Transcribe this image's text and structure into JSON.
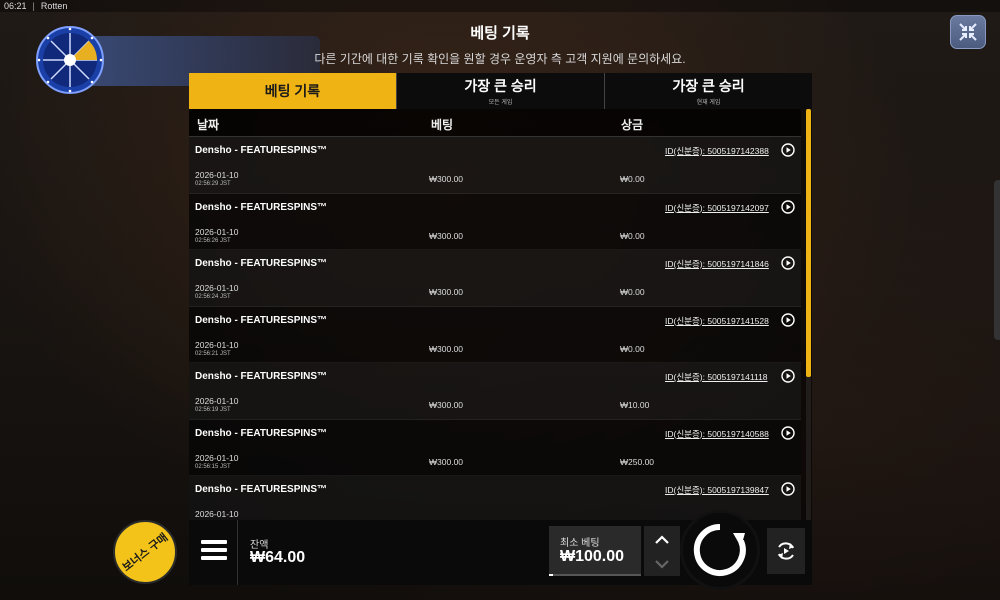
{
  "status_bar": {
    "time": "06:21",
    "app": "Rotten"
  },
  "header": {
    "title": "베팅 기록",
    "subtitle": "다른 기간에 대한 기록 확인을 원할 경우 운영자 측 고객 지원에 문의하세요."
  },
  "tabs": [
    {
      "label": "베팅 기록",
      "sub": "",
      "active": true
    },
    {
      "label": "가장 큰 승리",
      "sub": "모든 게임",
      "active": false
    },
    {
      "label": "가장 큰 승리",
      "sub": "현재 게임",
      "active": false
    }
  ],
  "table": {
    "headers": {
      "date": "날짜",
      "bet": "베팅",
      "win": "상금"
    },
    "rows": [
      {
        "game": "Densho - FEATURESPINS™",
        "date": "2026-01-10",
        "time": "02:56:29 JST",
        "bet": "₩300.00",
        "win": "₩0.00",
        "id": "ID(신분증): 5005197142388"
      },
      {
        "game": "Densho - FEATURESPINS™",
        "date": "2026-01-10",
        "time": "02:56:26 JST",
        "bet": "₩300.00",
        "win": "₩0.00",
        "id": "ID(신분증): 5005197142097"
      },
      {
        "game": "Densho - FEATURESPINS™",
        "date": "2026-01-10",
        "time": "02:56:24 JST",
        "bet": "₩300.00",
        "win": "₩0.00",
        "id": "ID(신분증): 5005197141846"
      },
      {
        "game": "Densho - FEATURESPINS™",
        "date": "2026-01-10",
        "time": "02:56:21 JST",
        "bet": "₩300.00",
        "win": "₩0.00",
        "id": "ID(신분증): 5005197141528"
      },
      {
        "game": "Densho - FEATURESPINS™",
        "date": "2026-01-10",
        "time": "02:56:19 JST",
        "bet": "₩300.00",
        "win": "₩10.00",
        "id": "ID(신분증): 5005197141118"
      },
      {
        "game": "Densho - FEATURESPINS™",
        "date": "2026-01-10",
        "time": "02:56:15 JST",
        "bet": "₩300.00",
        "win": "₩250.00",
        "id": "ID(신분증): 5005197140588"
      },
      {
        "game": "Densho - FEATURESPINS™",
        "date": "2026-01-10",
        "time": "",
        "bet": "",
        "win": "",
        "id": "ID(신분증): 5005197139847"
      }
    ]
  },
  "bottom": {
    "balance_label": "잔액",
    "balance_value": "₩64.00",
    "minbet_label": "최소 베팅",
    "minbet_value": "₩100.00",
    "bonus_label": "보너스 구매"
  },
  "colors": {
    "accent": "#f0b314",
    "bonus": "#f3c31a"
  },
  "icons": {
    "wheel": "bonus-wheel-icon",
    "collapse": "collapse-icon",
    "menu": "hamburger-menu-icon",
    "play": "play-circle-icon",
    "spin": "spin-icon",
    "auto": "autoplay-icon",
    "up": "chevron-up-icon",
    "down": "chevron-down-icon"
  }
}
